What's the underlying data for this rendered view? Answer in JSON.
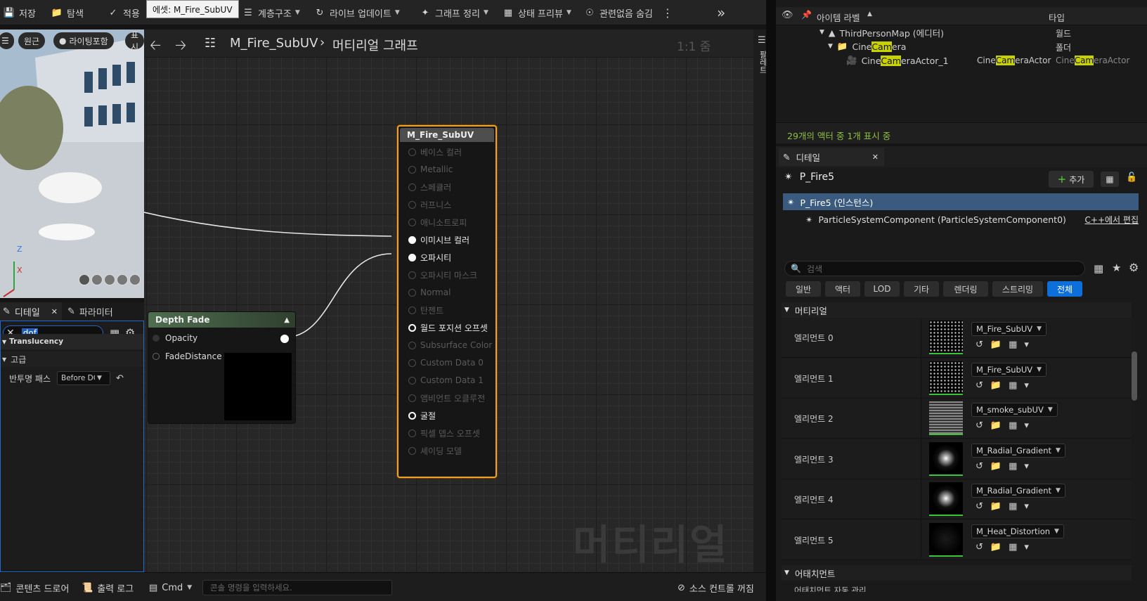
{
  "toolbar": {
    "save": "저장",
    "browse": "탐색",
    "apply": "적용",
    "hierarchy": "계층구조",
    "live_update": "라이브 업데이트",
    "graph_cleanup": "그래프 정리",
    "stats_preview": "상태 프리뷰",
    "hide_unrelated": "관련없음 숨김"
  },
  "tooltip": "에셋: M_Fire_SubUV",
  "viewport": {
    "perspective": "원근",
    "lighting": "라이팅포함",
    "show": "표시",
    "axis_z": "Z",
    "axis_x": "X"
  },
  "left_panel": {
    "tab_details": "디테일",
    "tab_params": "파라미터",
    "search_value": "dof",
    "category_translucency": "Translucency",
    "category_advanced": "고급",
    "prop_label": "반투명 패스",
    "prop_value": "Before DOF"
  },
  "graph": {
    "asset_name": "M_Fire_SubUV",
    "breadcrumb": "머티리얼 그래프",
    "zoom": "1:1 줌",
    "watermark": "머티리얼",
    "palette": "팔레트"
  },
  "main_node": {
    "title": "M_Fire_SubUV",
    "pins": [
      {
        "label": "베이스 컬러",
        "state": "inactive"
      },
      {
        "label": "Metallic",
        "state": "inactive"
      },
      {
        "label": "스페큘러",
        "state": "inactive"
      },
      {
        "label": "러프니스",
        "state": "inactive"
      },
      {
        "label": "애니소트로피",
        "state": "inactive"
      },
      {
        "label": "이미시브 컬러",
        "state": "active"
      },
      {
        "label": "오파시티",
        "state": "active"
      },
      {
        "label": "오파시티 마스크",
        "state": "inactive"
      },
      {
        "label": "Normal",
        "state": "inactive"
      },
      {
        "label": "탄젠트",
        "state": "inactive"
      },
      {
        "label": "월드 포지션 오프셋",
        "state": "ring"
      },
      {
        "label": "Subsurface Color",
        "state": "inactive"
      },
      {
        "label": "Custom Data 0",
        "state": "inactive"
      },
      {
        "label": "Custom Data 1",
        "state": "inactive"
      },
      {
        "label": "앰비언트 오클루전",
        "state": "inactive"
      },
      {
        "label": "굴절",
        "state": "ring"
      },
      {
        "label": "픽셀 뎁스 오프셋",
        "state": "inactive"
      },
      {
        "label": "셰이딩 모델",
        "state": "inactive"
      }
    ]
  },
  "depth_fade_node": {
    "title": "Depth Fade",
    "out_opacity": "Opacity",
    "in_fade_distance": "FadeDistance"
  },
  "bottom_bar": {
    "content_drawer": "콘텐츠 드로어",
    "output_log": "출력 로그",
    "cmd": "Cmd",
    "console_placeholder": "콘솔 명령을 입력하세요.",
    "source_control": "소스 컨트롤 꺼짐"
  },
  "outliner": {
    "col_label": "아이템 라벨",
    "col_type": "타입",
    "rows": [
      {
        "label": "ThirdPersonMap (에디터)",
        "type": "월드"
      },
      {
        "label_pre": "Cine",
        "label_hl": "Cam",
        "label_post": "era",
        "type": "폴더"
      },
      {
        "label_pre": "Cine",
        "label_hl": "Cam",
        "label_post": "eraActor_1",
        "class_pre": "Cine",
        "class_hl": "Cam",
        "class_post": "eraActor",
        "type_pre": "Cine",
        "type_hl": "Cam",
        "type_post": "eraActor"
      }
    ],
    "status": "29개의 액터 중 1개 표시 중"
  },
  "details": {
    "tab": "디테일",
    "actor_name": "P_Fire5",
    "add_button": "추가",
    "instance_row": "P_Fire5 (인스턴스)",
    "component_row": "ParticleSystemComponent (ParticleSystemComponent0)",
    "edit_cpp": "C++에서 편집",
    "search_placeholder": "검색",
    "categories": [
      "일반",
      "액터",
      "LOD",
      "기타",
      "렌더링",
      "스트리밍",
      "전체"
    ],
    "section_material": "머티리얼",
    "elements": [
      {
        "label": "엘리먼트 0",
        "material": "M_Fire_SubUV"
      },
      {
        "label": "엘리먼트 1",
        "material": "M_Fire_SubUV"
      },
      {
        "label": "엘리먼트 2",
        "material": "M_smoke_subUV"
      },
      {
        "label": "엘리먼트 3",
        "material": "M_Radial_Gradient"
      },
      {
        "label": "엘리먼트 4",
        "material": "M_Radial_Gradient"
      },
      {
        "label": "엘리먼트 5",
        "material": "M_Heat_Distortion"
      }
    ],
    "section_attachment": "어태치먼트",
    "attachment_row": "어태치먼트 자동 관리"
  },
  "colors": {
    "accent_orange": "#f5a623",
    "selection_blue": "#0d6fd9",
    "highlight_yellow": "#c8d200",
    "status_green": "#8fbf3f"
  }
}
